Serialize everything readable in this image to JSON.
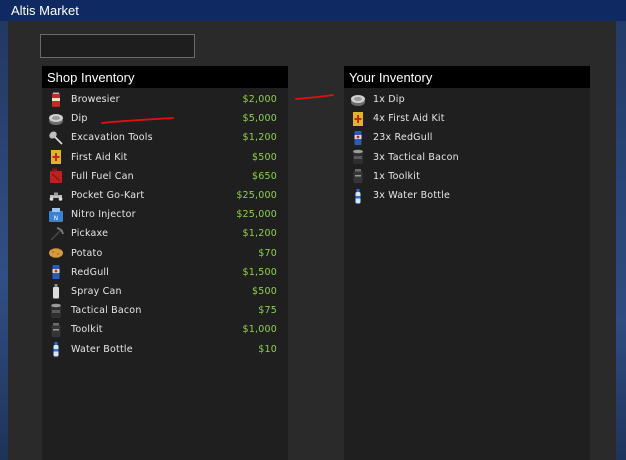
{
  "window": {
    "title": "Altis Market"
  },
  "search": {
    "value": "",
    "placeholder": ""
  },
  "shop": {
    "title": "Shop Inventory",
    "items": [
      {
        "name": "Browesier",
        "price": "$2,000",
        "icon": "soda-can-icon"
      },
      {
        "name": "Dip",
        "price": "$5,000",
        "icon": "dip-tin-icon"
      },
      {
        "name": "Excavation Tools",
        "price": "$1,200",
        "icon": "shovel-icon"
      },
      {
        "name": "First Aid Kit",
        "price": "$500",
        "icon": "first-aid-kit-icon"
      },
      {
        "name": "Full Fuel Can",
        "price": "$650",
        "icon": "fuel-can-icon"
      },
      {
        "name": "Pocket Go-Kart",
        "price": "$25,000",
        "icon": "go-kart-icon"
      },
      {
        "name": "Nitro Injector",
        "price": "$25,000",
        "icon": "nitro-injector-icon"
      },
      {
        "name": "Pickaxe",
        "price": "$1,200",
        "icon": "pickaxe-icon"
      },
      {
        "name": "Potato",
        "price": "$70",
        "icon": "potato-icon"
      },
      {
        "name": "RedGull",
        "price": "$1,500",
        "icon": "energy-drink-icon"
      },
      {
        "name": "Spray Can",
        "price": "$500",
        "icon": "spray-can-icon"
      },
      {
        "name": "Tactical Bacon",
        "price": "$75",
        "icon": "tactical-bacon-icon"
      },
      {
        "name": "Toolkit",
        "price": "$1,000",
        "icon": "toolkit-icon"
      },
      {
        "name": "Water Bottle",
        "price": "$10",
        "icon": "water-bottle-icon"
      }
    ]
  },
  "inventory": {
    "title": "Your Inventory",
    "items": [
      {
        "name": "1x Dip",
        "icon": "dip-tin-icon"
      },
      {
        "name": "4x First Aid Kit",
        "icon": "first-aid-kit-icon"
      },
      {
        "name": "23x RedGull",
        "icon": "energy-drink-icon"
      },
      {
        "name": "3x Tactical Bacon",
        "icon": "tactical-bacon-icon"
      },
      {
        "name": "1x Toolkit",
        "icon": "toolkit-icon"
      },
      {
        "name": "3x Water Bottle",
        "icon": "water-bottle-icon"
      }
    ]
  },
  "colors": {
    "title_bar": "#0f2a63",
    "panel_header": "#000000",
    "price": "#8fd14a",
    "annotation": "#e01010"
  }
}
